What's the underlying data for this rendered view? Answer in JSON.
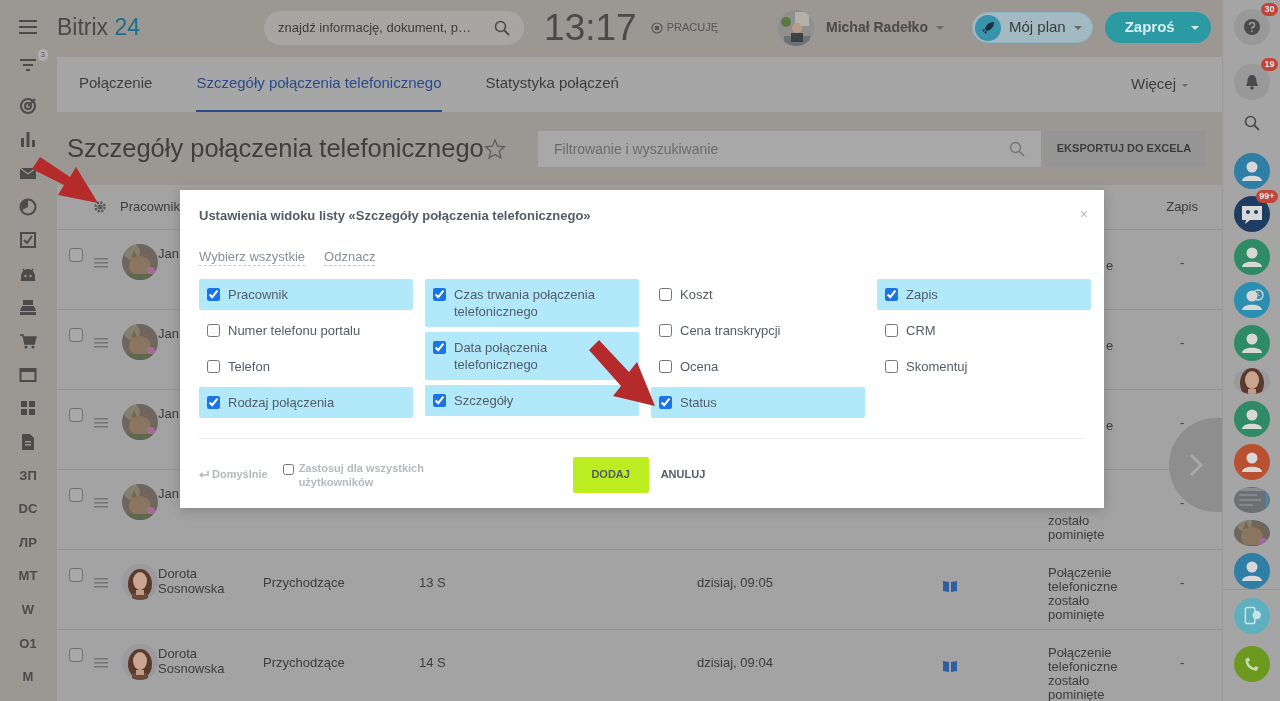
{
  "topbar": {
    "logo_name": "Bitrix",
    "logo_number": "24",
    "search": {
      "placeholder": "znajdź informację, dokument, p…"
    },
    "clock": "13:17",
    "work_status": "PRACUJĘ",
    "user": "Michał Radełko",
    "plan_button": "Mój plan",
    "invite_button": "Zaproś"
  },
  "left_sidebar": [
    {
      "kind": "filter",
      "badge": "3"
    },
    {
      "kind": "target"
    },
    {
      "kind": "chart"
    },
    {
      "kind": "mail"
    },
    {
      "kind": "clock"
    },
    {
      "kind": "tasks"
    },
    {
      "kind": "robot"
    },
    {
      "kind": "register"
    },
    {
      "kind": "cart"
    },
    {
      "kind": "window"
    },
    {
      "kind": "grid"
    },
    {
      "kind": "document"
    },
    {
      "kind": "text",
      "label": "ЗП"
    },
    {
      "kind": "text",
      "label": "DC"
    },
    {
      "kind": "text",
      "label": "ЛР"
    },
    {
      "kind": "text",
      "label": "MT"
    },
    {
      "kind": "text",
      "label": "W"
    },
    {
      "kind": "text",
      "label": "O1"
    },
    {
      "kind": "text",
      "label": "M"
    }
  ],
  "tabs": [
    {
      "label": "Połączenie",
      "selected": false
    },
    {
      "label": "Szczegóły połączenia telefonicznego",
      "selected": true
    },
    {
      "label": "Statystyka połączeń",
      "selected": false
    }
  ],
  "more_menu": "Więcej",
  "page_title": "Szczegóły połączenia telefonicznego",
  "filter": {
    "placeholder": "Filtrowanie i wyszukiwanie"
  },
  "export_button": "EKSPORTUJ DO EXCELA",
  "table": {
    "columns": [
      {
        "label": "Pracownik"
      },
      {
        "label": "Zapis"
      }
    ],
    "rows": [
      {
        "kind": "covered",
        "checked": false,
        "employee": "Jan",
        "status": "e",
        "record": "-"
      },
      {
        "kind": "covered",
        "checked": false,
        "employee": "Jan",
        "status": "e",
        "record": "-"
      },
      {
        "kind": "covered",
        "checked": false,
        "employee": "Jan",
        "status": "e",
        "record": "-"
      },
      {
        "kind": "covered-low",
        "checked": false,
        "employee": "Jan",
        "status": "zostało pominięte",
        "record": "-"
      },
      {
        "kind": "full",
        "checked": false,
        "employee": "Dorota Sosnowska",
        "call_type": "Przychodzące",
        "duration": "13 S",
        "date": "dzisiaj, 09:05",
        "status": "Połączenie telefoniczne zostało pominięte",
        "record": "-"
      },
      {
        "kind": "full",
        "checked": false,
        "employee": "Dorota Sosnowska",
        "call_type": "Przychodzące",
        "duration": "14 S",
        "date": "dzisiaj, 09:04",
        "status": "Połączenie telefoniczne zostało pominięte",
        "record": "-"
      }
    ]
  },
  "right_sidebar": {
    "top": [
      {
        "kind": "help",
        "badge": "30"
      },
      {
        "kind": "bell",
        "badge": "19"
      },
      {
        "kind": "search"
      }
    ],
    "contacts": [
      {
        "kind": "contact",
        "color": "#2f7ea5"
      },
      {
        "kind": "chat",
        "color": "#1f3d62",
        "badge": "99+"
      },
      {
        "kind": "contact",
        "color": "#2f8a68"
      },
      {
        "kind": "contact-clock",
        "color": "#2a8fb0"
      },
      {
        "kind": "contact",
        "color": "#2f8a68"
      },
      {
        "kind": "picture"
      },
      {
        "kind": "contact",
        "color": "#2f8a68"
      },
      {
        "kind": "contact",
        "color": "#b9502f"
      },
      {
        "kind": "picture"
      },
      {
        "kind": "picture"
      },
      {
        "kind": "contact",
        "color": "#2f7ea5"
      }
    ],
    "bottom": [
      {
        "kind": "phone-cloud"
      },
      {
        "kind": "phone"
      }
    ]
  },
  "modal": {
    "title": "Ustawienia widoku listy «Szczegóły połączenia telefonicznego»",
    "close": "×",
    "select_all": "Wybierz wszystkie",
    "deselect": "Odznacz",
    "columns": [
      [
        {
          "label": "Pracownik",
          "checked": true
        },
        {
          "label": "Numer telefonu portalu",
          "checked": false
        },
        {
          "label": "Telefon",
          "checked": false
        },
        {
          "label": "Rodzaj połączenia",
          "checked": true
        }
      ],
      [
        {
          "label": "Czas trwania połączenia telefonicznego",
          "checked": true
        },
        {
          "label": "Data połączenia telefonicznego",
          "checked": true
        },
        {
          "label": "Szczegóły",
          "checked": true
        }
      ],
      [
        {
          "label": "Koszt",
          "checked": false
        },
        {
          "label": "Cena transkrypcji",
          "checked": false
        },
        {
          "label": "Ocena",
          "checked": false
        },
        {
          "label": "Status",
          "checked": true
        }
      ],
      [
        {
          "label": "Zapis",
          "checked": true
        },
        {
          "label": "CRM",
          "checked": false
        },
        {
          "label": "Skomentuj",
          "checked": false
        }
      ]
    ],
    "default_link": "Domyślnie",
    "apply_all": {
      "label": "Zastosuj dla wszystkich użytkowników",
      "checked": false
    },
    "add_button": "DODAJ",
    "cancel_button": "ANULUJ"
  }
}
